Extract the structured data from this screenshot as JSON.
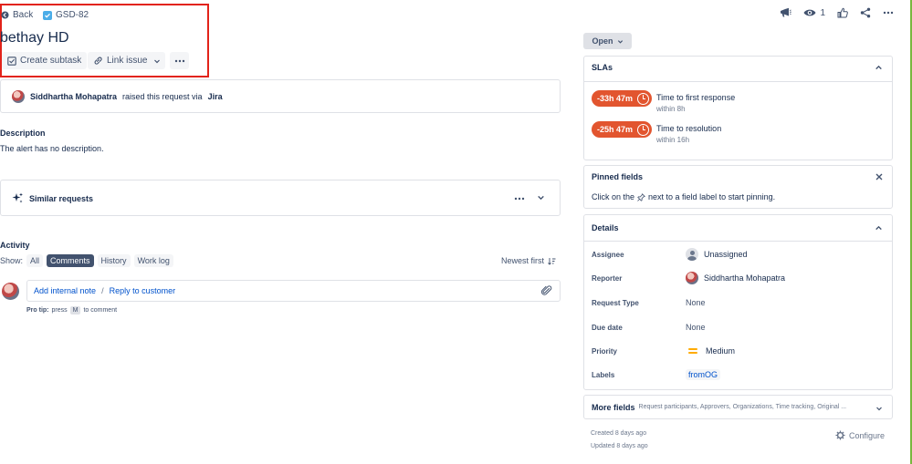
{
  "header": {
    "back_label": "Back",
    "issue_key": "GSD-82",
    "title": "bethay HD",
    "create_subtask_label": "Create subtask",
    "link_issue_label": "Link issue",
    "watch_count": "1"
  },
  "request": {
    "requester": "Siddhartha Mohapatra",
    "raised_text": "raised this request via",
    "channel": "Jira"
  },
  "description": {
    "heading": "Description",
    "text": "The alert has no description."
  },
  "similar": {
    "title": "Similar requests"
  },
  "activity": {
    "heading": "Activity",
    "show_label": "Show:",
    "filters": [
      "All",
      "Comments",
      "History",
      "Work log"
    ],
    "active_filter": "Comments",
    "sort_label": "Newest first",
    "add_internal_note": "Add internal note",
    "separator": "/",
    "reply_to_customer": "Reply to customer",
    "protip_label": "Pro tip:",
    "protip_press": "press",
    "protip_key": "M",
    "protip_rest": "to comment"
  },
  "status": {
    "label": "Open"
  },
  "slas": {
    "heading": "SLAs",
    "items": [
      {
        "time": "-33h 47m",
        "name": "Time to first response",
        "within": "within 8h"
      },
      {
        "time": "-25h 47m",
        "name": "Time to resolution",
        "within": "within 16h"
      }
    ]
  },
  "pinned": {
    "heading": "Pinned fields",
    "hint_before": "Click on the",
    "hint_after": "next to a field label to start pinning."
  },
  "details": {
    "heading": "Details",
    "rows": [
      {
        "label": "Assignee",
        "value": "Unassigned"
      },
      {
        "label": "Reporter",
        "value": "Siddhartha Mohapatra"
      },
      {
        "label": "Request Type",
        "value": "None"
      },
      {
        "label": "Due date",
        "value": "None"
      },
      {
        "label": "Priority",
        "value": "Medium"
      },
      {
        "label": "Labels",
        "value": "fromOG"
      }
    ]
  },
  "more_fields": {
    "heading": "More fields",
    "summary": "Request participants, Approvers, Organizations, Time tracking, Original ..."
  },
  "meta": {
    "created": "Created 8 days ago",
    "updated": "Updated 8 days ago",
    "configure_label": "Configure"
  },
  "colors": {
    "sla_breached": "#e2552f",
    "priority_medium": "#ffab00",
    "link": "#0052cc",
    "highlight_box": "#e2231a"
  }
}
